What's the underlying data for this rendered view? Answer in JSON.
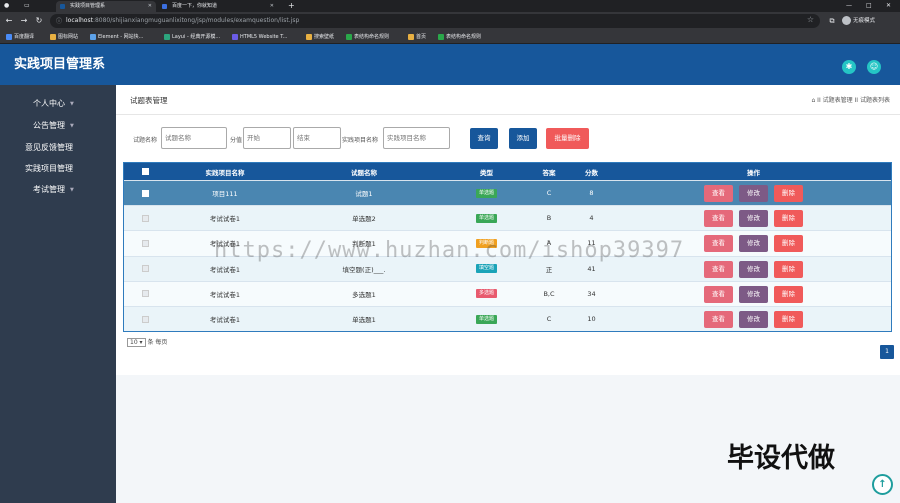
{
  "browser": {
    "tabs": [
      {
        "title": "实践项目管理系",
        "active": true
      },
      {
        "title": "百度一下，你就知道",
        "active": false
      }
    ],
    "new_tab": "+",
    "url_host": "localhost",
    "url_rest": ":8080/shijianxiangmuguanlixitong/jsp/modules/examquestion/list.jsp",
    "profile": "无痕模式",
    "window_controls": [
      "—",
      "□",
      "✕"
    ],
    "bookmarks": [
      "百度翻译",
      "图标网站",
      "Element - 网站快...",
      "Layui - 经典开源模...",
      "HTML5 Website T...",
      "搜索壁纸",
      "表结构命名规则",
      "首页",
      "表结构命名规则"
    ]
  },
  "app": {
    "title": "实践项目管理系",
    "header_icons": [
      "settings-icon",
      "user-icon"
    ]
  },
  "sidebar": {
    "items": [
      {
        "label": "个人中心",
        "has_chevron": true
      },
      {
        "label": "公告管理",
        "has_chevron": true
      },
      {
        "label": "意见反馈管理",
        "has_chevron": false
      },
      {
        "label": "实践项目管理",
        "has_chevron": false
      },
      {
        "label": "考试管理",
        "has_chevron": true
      }
    ]
  },
  "page": {
    "title": "试题表管理",
    "breadcrumb": "⌂ II  试题表管理  II  试题表列表"
  },
  "filters": {
    "name_label": "试题名称",
    "name_placeholder": "试题名称",
    "score_label": "分值",
    "score_from_placeholder": "开始",
    "score_to_placeholder": "结束",
    "project_label": "实践项目名称",
    "project_placeholder": "实践项目名称",
    "search_btn": "查询",
    "add_btn": "添加",
    "batch_delete_btn": "批量删除"
  },
  "table": {
    "headers": [
      "实践项目名称",
      "试题名称",
      "类型",
      "答案",
      "分数",
      "操作"
    ],
    "rows": [
      {
        "project": "项目111",
        "name": "试题1",
        "type": "单选题",
        "type_color": "#3aa757",
        "answer": "C",
        "score": "8"
      },
      {
        "project": "考试试卷1",
        "name": "单选题2",
        "type": "单选题",
        "type_color": "#3aa757",
        "answer": "B",
        "score": "4"
      },
      {
        "project": "考试试卷1",
        "name": "判断题1",
        "type": "判断题",
        "type_color": "#f0a020",
        "answer": "A",
        "score": "11"
      },
      {
        "project": "考试试卷1",
        "name": "填空题(正)___.",
        "type": "填空题",
        "type_color": "#1aa3b8",
        "answer": "正",
        "score": "41"
      },
      {
        "project": "考试试卷1",
        "name": "多选题1",
        "type": "多选题",
        "type_color": "#e85a6e",
        "answer": "B,C",
        "score": "34"
      },
      {
        "project": "考试试卷1",
        "name": "单选题1",
        "type": "单选题",
        "type_color": "#3aa757",
        "answer": "C",
        "score": "10"
      }
    ],
    "actions": {
      "view": "查看",
      "edit": "修改",
      "delete": "删除"
    }
  },
  "pagination": {
    "page_size": "10",
    "page_size_suffix": "条 每页",
    "current_page": "1"
  },
  "overlay": {
    "watermark": "https://www.huzhan.com/ishop39397",
    "big_text": "毕设代做"
  },
  "colors": {
    "header_bg": "#17579b",
    "sidebar_bg": "#2f3c4e",
    "view_btn": "#e5697a",
    "edit_btn": "#7d5a86",
    "delete_btn": "#f05a5a"
  }
}
